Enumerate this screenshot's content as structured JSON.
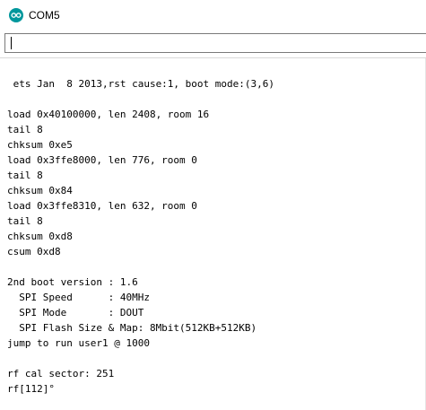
{
  "window": {
    "title": "COM5",
    "icon": "arduino-infinity-icon",
    "accent_color": "#00979c"
  },
  "send": {
    "value": ""
  },
  "output": {
    "lines": [
      " ets Jan  8 2013,rst cause:1, boot mode:(3,6)",
      "",
      "load 0x40100000, len 2408, room 16",
      "tail 8",
      "chksum 0xe5",
      "load 0x3ffe8000, len 776, room 0",
      "tail 8",
      "chksum 0x84",
      "load 0x3ffe8310, len 632, room 0",
      "tail 8",
      "chksum 0xd8",
      "csum 0xd8",
      "",
      "2nd boot version : 1.6",
      "  SPI Speed      : 40MHz",
      "  SPI Mode       : DOUT",
      "  SPI Flash Size & Map: 8Mbit(512KB+512KB)",
      "jump to run user1 @ 1000",
      "",
      "rf cal sector: 251",
      "rf[112]°"
    ]
  }
}
